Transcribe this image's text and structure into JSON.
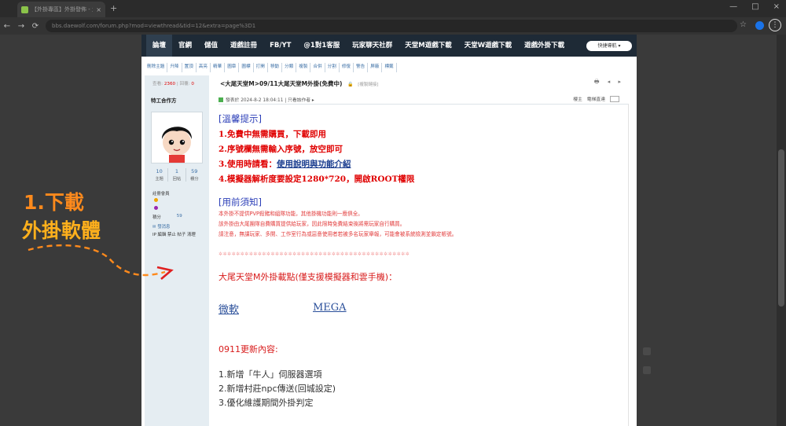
{
  "browser": {
    "tab_title": "【外掛專區】外掛發佈 - 大尾天堂",
    "tab_close": "×",
    "new_tab": "+",
    "url": "bbs.daewolf.com/forum.php?mod=viewthread&tid=12&extra=page%3D1",
    "nav_back": "←",
    "nav_forward": "→",
    "nav_reload": "⟳",
    "win_controls": [
      "—",
      "□",
      "×"
    ],
    "star": "☆",
    "menu": "⋮"
  },
  "topnav": {
    "items": [
      "論壇",
      "官網",
      "儲值",
      "遊戲註冊",
      "FB/YT",
      "@1對1客服",
      "玩家聊天社群",
      "天堂M遊戲下載",
      "天堂W遊戲下載",
      "遊戲外掛下載"
    ],
    "quick_nav": "快捷導航 ▾"
  },
  "toolbar": {
    "items": [
      "刪除主題",
      "升降",
      "置頂",
      "高亮",
      "精華",
      "圖章",
      "圖標",
      "打開",
      "移動",
      "分類",
      "複製",
      "合併",
      "分割",
      "修復",
      "警告",
      "屏蔽",
      "標籤"
    ]
  },
  "sidebar": {
    "view_label": "查看:",
    "views": "2360",
    "reply_label": "| 回覆:",
    "replies": "0",
    "author": "特工合作方",
    "counts": [
      {
        "num": "10",
        "label": "主題"
      },
      {
        "num": "1",
        "label": "回帖"
      },
      {
        "num": "59",
        "label": "積分"
      }
    ],
    "member_group": "註冊會員",
    "credit_label": "積分",
    "credit_value": "59",
    "send_msg": "✉ 發消息",
    "ip_actions": "IP 編輯 禁止 帖子 清理"
  },
  "post": {
    "title": "<大尾天堂M>09/11大尾天堂M外掛(免費中)",
    "lock": "🔒",
    "copy_link": "[複製鏈接]",
    "title_tools": "🖶 ◂ ▸",
    "meta": "發表於 2024-8-2 18:04:11 | 只看該作者 ▸",
    "meta_right_label": "樓主",
    "meta_jump": "電梯直達",
    "tips_title": "[溫馨提示]",
    "tips": [
      "1.免費中無需購買，下載即用",
      "2.序號欄無需輸入序號，放空即可",
      "3.使用時請看：",
      "4.模擬器解析度要設定1280*720，開啟ROOT權限"
    ],
    "tips_link": "使用說明與功能介紹",
    "notice_title": "[用前須知]",
    "notices": [
      "本外掛不提供PVP殺豬和組隊功能，其他掛機功能則一應俱全。",
      "該外掛由大尾團隊自費購買提供給玩家，因此限時免費結束後將需玩家自行購買。",
      "請注意，無課玩家、多開、工作室行為或惡意使用者若被多名玩家舉報，可能會被系統檢測並鎖定帳號。"
    ],
    "stars": "✲✲✲✲✲✲✲✲✲✲✲✲✲✲✲✲✲✲✲✲✲✲✲✲✲✲✲✲✲✲✲✲✲✲✲✲✲✲✲✲✲✲✲✲",
    "download_point": "大尾天堂M外掛載點(僅支援模擬器和雲手機)：",
    "link_microsoft": "微軟",
    "link_mega": "MEGA",
    "update_title": "0911更新內容:",
    "updates": [
      "1.新增「牛人」伺服器選項",
      "2.新增村莊npc傳送(回城設定)",
      "3.優化維護期間外掛判定"
    ]
  },
  "annotation": {
    "line1": "1.下載",
    "line2": "外掛軟體"
  }
}
